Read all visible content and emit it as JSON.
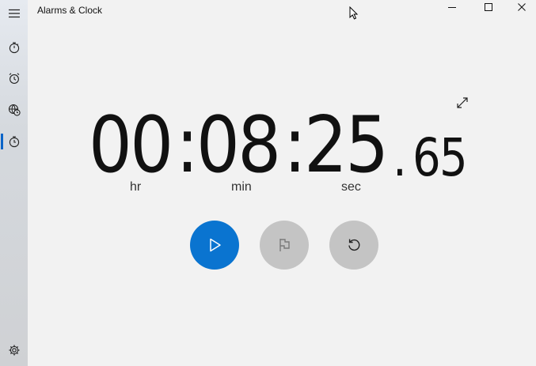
{
  "window": {
    "title": "Alarms & Clock",
    "controls": [
      "minimize",
      "maximize",
      "close"
    ]
  },
  "sidebar": {
    "items": [
      {
        "name": "menu",
        "icon": "hamburger-icon"
      },
      {
        "name": "timer",
        "icon": "timer-icon"
      },
      {
        "name": "alarm",
        "icon": "alarm-clock-icon"
      },
      {
        "name": "world-clock",
        "icon": "world-clock-icon"
      },
      {
        "name": "stopwatch",
        "icon": "stopwatch-icon",
        "active": true
      },
      {
        "name": "settings",
        "icon": "gear-icon"
      }
    ]
  },
  "stopwatch": {
    "hours": "00",
    "minutes": "08",
    "seconds": "25",
    "hundredths": "65",
    "sep1": ":",
    "sep2": ":",
    "dot": ".",
    "labels": {
      "hr": "hr",
      "min": "min",
      "sec": "sec"
    },
    "buttons": [
      {
        "name": "start",
        "icon": "play-icon",
        "color": "#0a74d0"
      },
      {
        "name": "lap",
        "icon": "flag-icon",
        "color": "#c4c4c4",
        "disabled": true
      },
      {
        "name": "reset",
        "icon": "reset-icon",
        "color": "#c4c4c4"
      }
    ]
  },
  "colors": {
    "accent": "#0a74d0",
    "background": "#f2f2f2",
    "inactive_button": "#c4c4c4"
  }
}
